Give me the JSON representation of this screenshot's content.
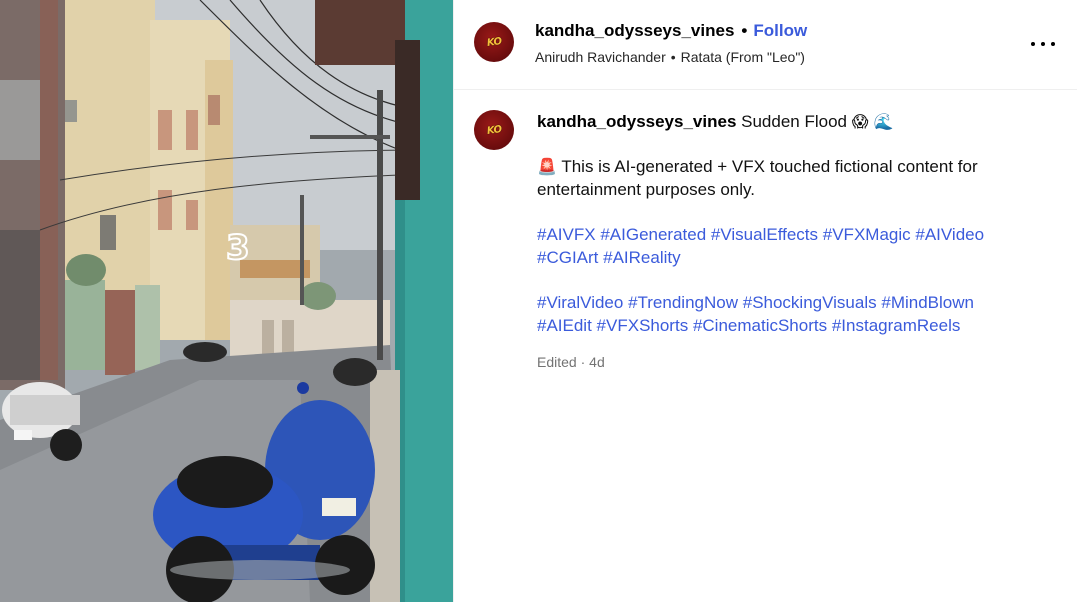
{
  "post": {
    "username": "kandha_odysseys_vines",
    "follow_label": "Follow",
    "separator": "•",
    "audio_artist": "Anirudh Ravichander",
    "audio_track": "Ratata (From \"Leo\")",
    "avatar_monogram": "KO",
    "more_options_icon": "more-horizontal-icon"
  },
  "media": {
    "countdown_digit": "3",
    "description_icon": "video-frame"
  },
  "caption": {
    "username": "kandha_odysseys_vines",
    "title_text": "Sudden Flood",
    "title_emojis": "😱 🌊",
    "disclaimer_emoji": "🚨",
    "disclaimer_text": "This is AI-generated + VFX touched fictional content for entertainment purposes only.",
    "hashtags_group1": [
      "#AIVFX",
      "#AIGenerated",
      "#VisualEffects",
      "#VFXMagic",
      "#AIVideo",
      "#CGIArt",
      "#AIReality"
    ],
    "hashtags_group2": [
      "#ViralVideo",
      "#TrendingNow",
      "#ShockingVisuals",
      "#MindBlown",
      "#AIEdit",
      "#VFXShorts",
      "#CinematicShorts",
      "#InstagramReels"
    ],
    "edited_label": "Edited",
    "meta_separator": "·",
    "age": "4d"
  },
  "colors": {
    "link_blue": "#3b5bdb",
    "avatar_red": "#7a0e0f",
    "avatar_text": "#f5c23a",
    "meta_gray": "#737373"
  }
}
